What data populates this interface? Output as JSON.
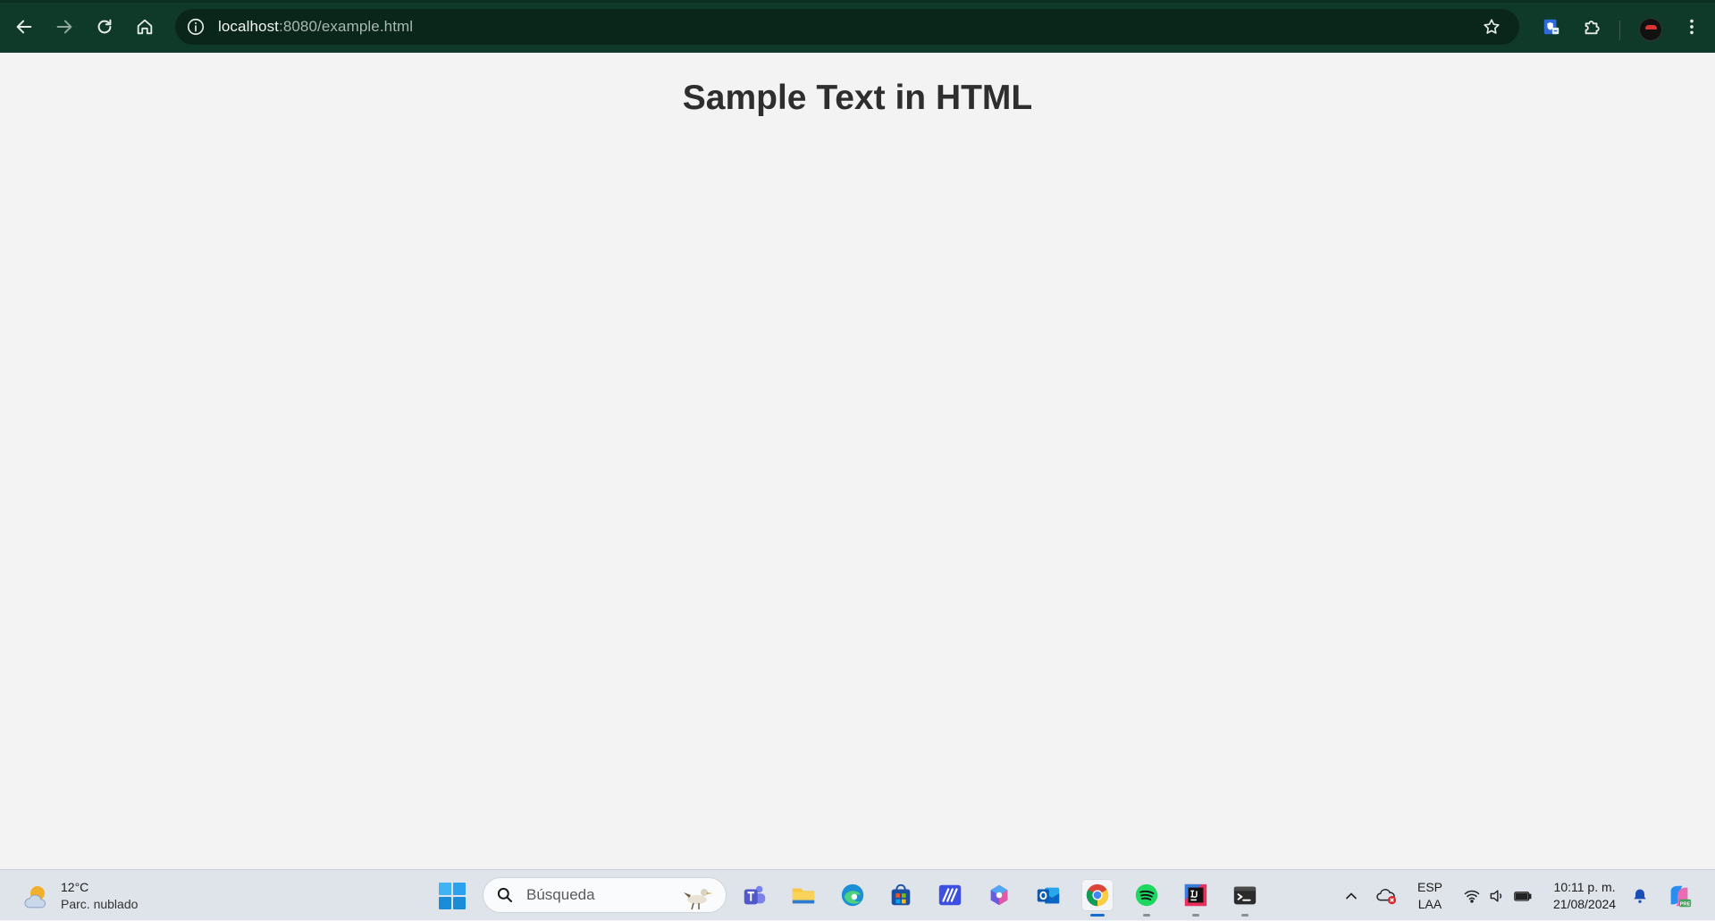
{
  "browser": {
    "url_host": "localhost",
    "url_path": ":8080/example.html",
    "icons": [
      "back-icon",
      "forward-icon",
      "reload-icon",
      "home-icon",
      "site-info-icon",
      "bookmark-star-icon",
      "extension-shield-icon",
      "extensions-puzzle-icon",
      "profile-avatar",
      "more-menu-icon"
    ]
  },
  "page": {
    "heading": "Sample Text in HTML"
  },
  "taskbar": {
    "weather": {
      "temp": "12°C",
      "desc": "Parc. nublado"
    },
    "search_placeholder": "Búsqueda",
    "apps": [
      "teams",
      "file-explorer",
      "edge",
      "store",
      "app-m",
      "copilot",
      "outlook",
      "chrome",
      "spotify",
      "intellij",
      "terminal"
    ],
    "tray": {
      "lang_top": "ESP",
      "lang_bottom": "LAA",
      "time": "10:11 p. m.",
      "date": "21/08/2024"
    }
  },
  "colors": {
    "toolbar": "#0f3a2a",
    "omnibox": "#0a2519",
    "page_bg": "#f3f3f3",
    "taskbar": "#dfe3ea"
  }
}
